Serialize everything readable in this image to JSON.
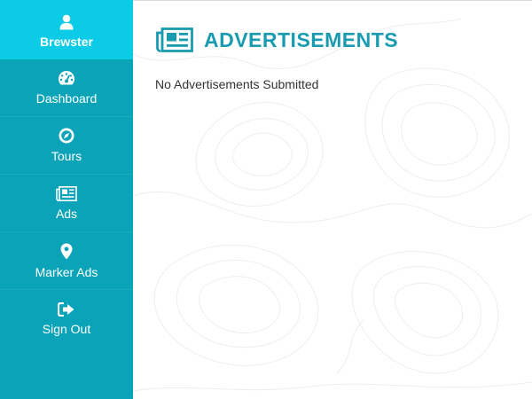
{
  "sidebar": {
    "user": {
      "name": "Brewster",
      "icon": "user-icon"
    },
    "items": [
      {
        "label": "Dashboard",
        "icon": "speedometer-icon"
      },
      {
        "label": "Tours",
        "icon": "compass-icon"
      },
      {
        "label": "Ads",
        "icon": "newspaper-icon"
      },
      {
        "label": "Marker Ads",
        "icon": "map-marker-icon"
      },
      {
        "label": "Sign Out",
        "icon": "sign-out-icon"
      }
    ]
  },
  "main": {
    "title": "ADVERTISEMENTS",
    "title_icon": "newspaper-icon",
    "empty_message": "No Advertisements Submitted"
  },
  "colors": {
    "sidebar": "#0aa3b8",
    "sidebar_active": "#0ccbe6",
    "accent": "#1a9bb0",
    "text": "#333333"
  }
}
